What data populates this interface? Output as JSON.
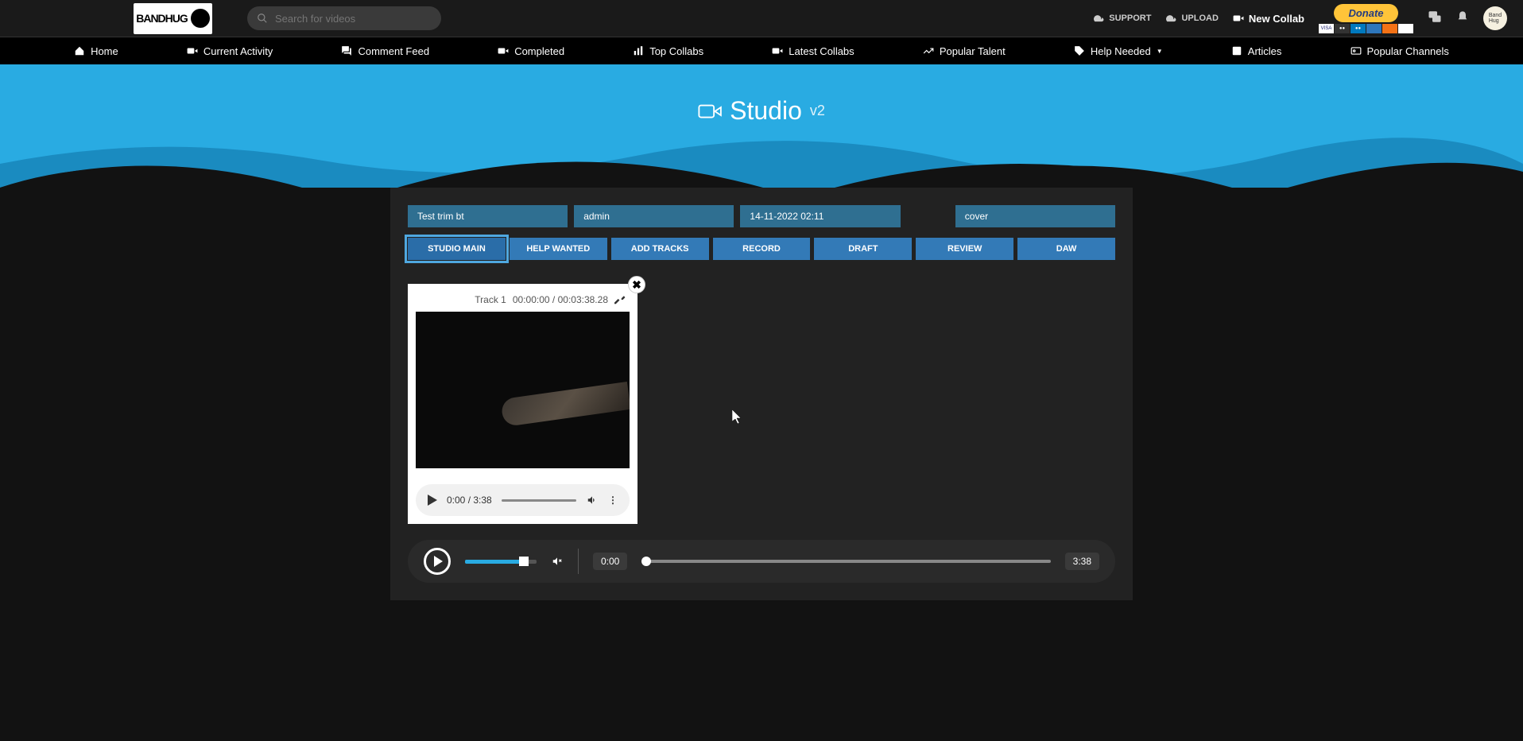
{
  "header": {
    "logo_text": "BANDHUG",
    "search_placeholder": "Search for videos",
    "support": "SUPPORT",
    "upload": "UPLOAD",
    "new_collab": "New Collab",
    "donate": "Donate"
  },
  "nav": {
    "home": "Home",
    "current_activity": "Current Activity",
    "comment_feed": "Comment Feed",
    "completed": "Completed",
    "top_collabs": "Top Collabs",
    "latest_collabs": "Latest Collabs",
    "popular_talent": "Popular Talent",
    "help_needed": "Help Needed",
    "articles": "Articles",
    "popular_channels": "Popular Channels"
  },
  "hero": {
    "title": "Studio",
    "version": "v2"
  },
  "info": {
    "title": "Test trim bt",
    "user": "admin",
    "date": "14-11-2022 02:11",
    "type": "cover"
  },
  "tabs": {
    "studio_main": "STUDIO MAIN",
    "help_wanted": "HELP WANTED",
    "add_tracks": "ADD TRACKS",
    "record": "RECORD",
    "draft": "DRAFT",
    "review": "REVIEW",
    "daw": "DAW"
  },
  "track": {
    "label": "Track 1",
    "current": "00:00:00",
    "total": "00:03:38.28",
    "audio_current": "0:00",
    "audio_total": "3:38"
  },
  "player": {
    "time_start": "0:00",
    "time_end": "3:38"
  }
}
